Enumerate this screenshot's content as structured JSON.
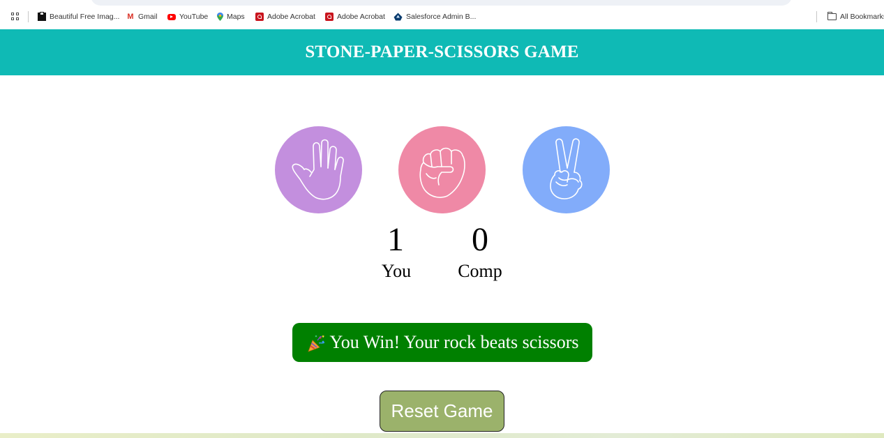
{
  "bookmarks": {
    "items": [
      {
        "label": "Beautiful Free Imag...",
        "icon": "image-site-icon"
      },
      {
        "label": "Gmail",
        "icon": "gmail-icon"
      },
      {
        "label": "YouTube",
        "icon": "youtube-icon"
      },
      {
        "label": "Maps",
        "icon": "maps-pin-icon"
      },
      {
        "label": "Adobe Acrobat",
        "icon": "adobe-acrobat-icon"
      },
      {
        "label": "Adobe Acrobat",
        "icon": "adobe-acrobat-icon"
      },
      {
        "label": "Salesforce Admin B...",
        "icon": "salesforce-trailhead-icon"
      }
    ],
    "all_bookmarks": "All Bookmarks"
  },
  "header": {
    "title": "STONE-PAPER-SCISSORS GAME",
    "background": "#0fbab5"
  },
  "choices": [
    {
      "id": "paper",
      "icon": "open-hand-icon",
      "color": "#c38fde"
    },
    {
      "id": "rock",
      "icon": "fist-icon",
      "color": "#ef89a6"
    },
    {
      "id": "scissors",
      "icon": "peace-hand-icon",
      "color": "#82acfa"
    }
  ],
  "score": {
    "user": "1",
    "user_label": "You",
    "comp": "0",
    "comp_label": "Comp"
  },
  "message": {
    "text": "You Win! Your rock beats scissors",
    "icon": "party-popper-icon",
    "background": "#008000"
  },
  "reset": {
    "label": "Reset Game",
    "background": "#9bb26b"
  }
}
